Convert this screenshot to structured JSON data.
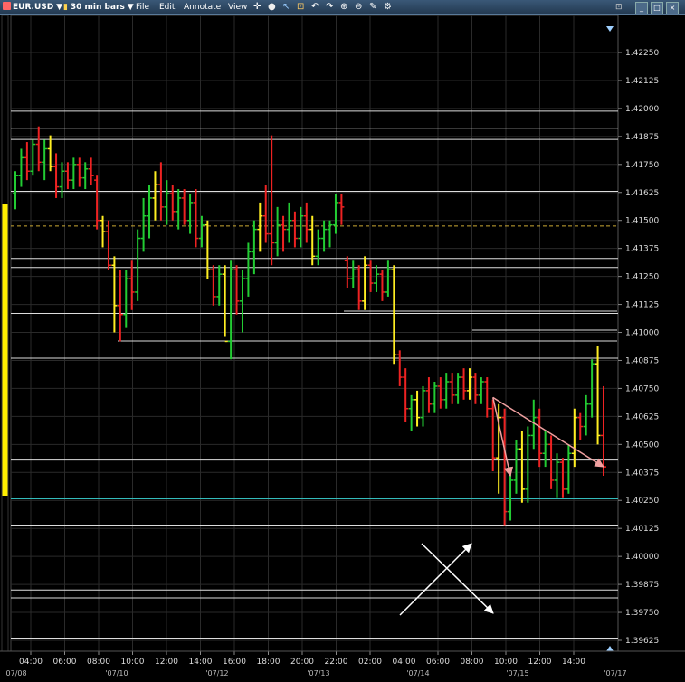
{
  "toolbar": {
    "symbol": "EUR.USD",
    "interval": "30 min bars",
    "menu": [
      {
        "label": "File"
      },
      {
        "label": "Edit"
      },
      {
        "label": "Annotate"
      },
      {
        "label": "View"
      }
    ],
    "tool_icons": [
      "crosshair-icon",
      "dot-icon",
      "pointer-icon",
      "measure-icon",
      "undo-icon",
      "redo-icon",
      "undo-icon-2",
      "zoom-in-icon",
      "zoom-out-icon",
      "zoom-reset-icon",
      "wrench-icon",
      "settings-icon",
      "lock-icon"
    ],
    "window_buttons": [
      "minimize-icon",
      "maximize-icon",
      "close-icon"
    ]
  },
  "colors": {
    "up": "#22cc33",
    "down": "#ee2222",
    "flat": "#ffee22",
    "neutral": "#eeeeee",
    "hline": "#dddddd",
    "dashed": "#ccaa33",
    "cyan": "#33bbbb",
    "arrow": "#f0a0a0",
    "grid": "#2a2a2a",
    "volume_bar": "#ffee00"
  },
  "chart_data": {
    "type": "ohlc",
    "ylim": [
      1.39625,
      1.42375
    ],
    "y_ticks": [
      "1.42250",
      "1.42125",
      "1.42000",
      "1.41875",
      "1.41750",
      "1.41625",
      "1.41500",
      "1.41375",
      "1.41250",
      "1.41125",
      "1.41000",
      "1.40875",
      "1.40750",
      "1.40625",
      "1.40500",
      "1.40375",
      "1.40250",
      "1.40125",
      "1.40000",
      "1.39875",
      "1.39750",
      "1.39625"
    ],
    "x_ticks": [
      "04:00",
      "06:00",
      "08:00",
      "10:00",
      "12:00",
      "14:00",
      "16:00",
      "18:00",
      "20:00",
      "22:00",
      "02:00",
      "04:00",
      "06:00",
      "08:00",
      "10:00",
      "12:00",
      "14:00"
    ],
    "x_dates": [
      "'07/08",
      "'07/10",
      "'07/12",
      "'07/13",
      "'07/14",
      "'07/15",
      "'07/17"
    ],
    "horizontal_lines": [
      1.41988,
      1.41912,
      1.41862,
      1.4163,
      1.4133,
      1.4129,
      1.41085,
      1.40885,
      1.4043,
      1.4014,
      1.3985,
      1.39815,
      1.39635
    ],
    "dashed_line": 1.41475,
    "cyan_line": 1.40257,
    "bars": [
      {
        "o": 1.4162,
        "h": 1.4172,
        "l": 1.4155,
        "c": 1.417
      },
      {
        "o": 1.417,
        "h": 1.4182,
        "l": 1.4165,
        "c": 1.4178
      },
      {
        "o": 1.4178,
        "h": 1.4185,
        "l": 1.4168,
        "c": 1.4172
      },
      {
        "o": 1.4172,
        "h": 1.4186,
        "l": 1.417,
        "c": 1.4184
      },
      {
        "o": 1.4184,
        "h": 1.4192,
        "l": 1.4172,
        "c": 1.4176
      },
      {
        "o": 1.4176,
        "h": 1.4186,
        "l": 1.4168,
        "c": 1.4182
      },
      {
        "o": 1.4182,
        "h": 1.4188,
        "l": 1.4172,
        "c": 1.4174
      },
      {
        "o": 1.4174,
        "h": 1.418,
        "l": 1.416,
        "c": 1.4165
      },
      {
        "o": 1.4165,
        "h": 1.4176,
        "l": 1.416,
        "c": 1.4172
      },
      {
        "o": 1.4172,
        "h": 1.4176,
        "l": 1.4164,
        "c": 1.4168
      },
      {
        "o": 1.4168,
        "h": 1.4178,
        "l": 1.4164,
        "c": 1.4175
      },
      {
        "o": 1.4175,
        "h": 1.4178,
        "l": 1.4165,
        "c": 1.4169
      },
      {
        "o": 1.4169,
        "h": 1.4176,
        "l": 1.4164,
        "c": 1.4173
      },
      {
        "o": 1.4173,
        "h": 1.4178,
        "l": 1.4166,
        "c": 1.417
      },
      {
        "o": 1.4168,
        "h": 1.417,
        "l": 1.4146,
        "c": 1.415
      },
      {
        "o": 1.415,
        "h": 1.4152,
        "l": 1.4138,
        "c": 1.4145
      },
      {
        "o": 1.4145,
        "h": 1.415,
        "l": 1.4128,
        "c": 1.413
      },
      {
        "o": 1.413,
        "h": 1.4134,
        "l": 1.41,
        "c": 1.4112
      },
      {
        "o": 1.4112,
        "h": 1.4128,
        "l": 1.4096,
        "c": 1.4108
      },
      {
        "o": 1.4108,
        "h": 1.4128,
        "l": 1.4102,
        "c": 1.4124
      },
      {
        "o": 1.4124,
        "h": 1.4132,
        "l": 1.411,
        "c": 1.4118
      },
      {
        "o": 1.4118,
        "h": 1.4146,
        "l": 1.4114,
        "c": 1.4142
      },
      {
        "o": 1.4142,
        "h": 1.416,
        "l": 1.4136,
        "c": 1.4152
      },
      {
        "o": 1.4152,
        "h": 1.4166,
        "l": 1.4142,
        "c": 1.416
      },
      {
        "o": 1.416,
        "h": 1.4172,
        "l": 1.415,
        "c": 1.4166
      },
      {
        "o": 1.4166,
        "h": 1.4176,
        "l": 1.415,
        "c": 1.4156
      },
      {
        "o": 1.4156,
        "h": 1.4168,
        "l": 1.4148,
        "c": 1.4162
      },
      {
        "o": 1.4162,
        "h": 1.4166,
        "l": 1.415,
        "c": 1.4154
      },
      {
        "o": 1.4154,
        "h": 1.4164,
        "l": 1.4146,
        "c": 1.416
      },
      {
        "o": 1.416,
        "h": 1.4164,
        "l": 1.4148,
        "c": 1.415
      },
      {
        "o": 1.415,
        "h": 1.4162,
        "l": 1.4144,
        "c": 1.4158
      },
      {
        "o": 1.4158,
        "h": 1.4164,
        "l": 1.4138,
        "c": 1.4142
      },
      {
        "o": 1.4142,
        "h": 1.4152,
        "l": 1.4138,
        "c": 1.4148
      },
      {
        "o": 1.4148,
        "h": 1.415,
        "l": 1.4124,
        "c": 1.4128
      },
      {
        "o": 1.4128,
        "h": 1.413,
        "l": 1.4112,
        "c": 1.4116
      },
      {
        "o": 1.4116,
        "h": 1.413,
        "l": 1.4112,
        "c": 1.4126
      },
      {
        "o": 1.4126,
        "h": 1.413,
        "l": 1.4098,
        "c": 1.4096
      },
      {
        "o": 1.4096,
        "h": 1.4132,
        "l": 1.4088,
        "c": 1.4128
      },
      {
        "o": 1.4128,
        "h": 1.413,
        "l": 1.4108,
        "c": 1.4114
      },
      {
        "o": 1.4114,
        "h": 1.4128,
        "l": 1.41,
        "c": 1.4124
      },
      {
        "o": 1.4124,
        "h": 1.414,
        "l": 1.4116,
        "c": 1.4136
      },
      {
        "o": 1.4136,
        "h": 1.415,
        "l": 1.4126,
        "c": 1.4146
      },
      {
        "o": 1.4146,
        "h": 1.4158,
        "l": 1.4136,
        "c": 1.4152
      },
      {
        "o": 1.4152,
        "h": 1.4166,
        "l": 1.414,
        "c": 1.4144
      },
      {
        "o": 1.4144,
        "h": 1.4188,
        "l": 1.413,
        "c": 1.414
      },
      {
        "o": 1.414,
        "h": 1.4156,
        "l": 1.4134,
        "c": 1.4148
      },
      {
        "o": 1.4148,
        "h": 1.4152,
        "l": 1.4136,
        "c": 1.4146
      },
      {
        "o": 1.4146,
        "h": 1.4158,
        "l": 1.414,
        "c": 1.415
      },
      {
        "o": 1.415,
        "h": 1.4154,
        "l": 1.4138,
        "c": 1.4142
      },
      {
        "o": 1.4142,
        "h": 1.4156,
        "l": 1.4138,
        "c": 1.4152
      },
      {
        "o": 1.4152,
        "h": 1.4158,
        "l": 1.414,
        "c": 1.4146
      },
      {
        "o": 1.4146,
        "h": 1.4152,
        "l": 1.413,
        "c": 1.4134
      },
      {
        "o": 1.4134,
        "h": 1.4146,
        "l": 1.413,
        "c": 1.4142
      },
      {
        "o": 1.4142,
        "h": 1.415,
        "l": 1.4136,
        "c": 1.4146
      },
      {
        "o": 1.4146,
        "h": 1.415,
        "l": 1.4138,
        "c": 1.4148
      },
      {
        "o": 1.4148,
        "h": 1.4162,
        "l": 1.4144,
        "c": 1.4158
      },
      {
        "o": 1.4158,
        "h": 1.4162,
        "l": 1.4148,
        "c": 1.4156
      },
      {
        "o": 1.4132,
        "h": 1.4134,
        "l": 1.412,
        "c": 1.4124
      },
      {
        "o": 1.4124,
        "h": 1.4132,
        "l": 1.412,
        "c": 1.4128
      },
      {
        "o": 1.4128,
        "h": 1.413,
        "l": 1.411,
        "c": 1.4114
      },
      {
        "o": 1.4114,
        "h": 1.4134,
        "l": 1.411,
        "c": 1.413
      },
      {
        "o": 1.413,
        "h": 1.4132,
        "l": 1.4118,
        "c": 1.4122
      },
      {
        "o": 1.4122,
        "h": 1.413,
        "l": 1.4118,
        "c": 1.4126
      },
      {
        "o": 1.4126,
        "h": 1.4128,
        "l": 1.4114,
        "c": 1.4118
      },
      {
        "o": 1.4118,
        "h": 1.4132,
        "l": 1.4116,
        "c": 1.4128
      },
      {
        "o": 1.4128,
        "h": 1.413,
        "l": 1.4086,
        "c": 1.409
      },
      {
        "o": 1.409,
        "h": 1.4092,
        "l": 1.4076,
        "c": 1.408
      },
      {
        "o": 1.408,
        "h": 1.4084,
        "l": 1.406,
        "c": 1.4066
      },
      {
        "o": 1.4066,
        "h": 1.4072,
        "l": 1.4056,
        "c": 1.407
      },
      {
        "o": 1.407,
        "h": 1.4074,
        "l": 1.4058,
        "c": 1.4062
      },
      {
        "o": 1.4062,
        "h": 1.4076,
        "l": 1.4058,
        "c": 1.4074
      },
      {
        "o": 1.4074,
        "h": 1.408,
        "l": 1.4064,
        "c": 1.4068
      },
      {
        "o": 1.4068,
        "h": 1.4078,
        "l": 1.4064,
        "c": 1.4076
      },
      {
        "o": 1.4076,
        "h": 1.408,
        "l": 1.4066,
        "c": 1.407
      },
      {
        "o": 1.407,
        "h": 1.4082,
        "l": 1.4066,
        "c": 1.4078
      },
      {
        "o": 1.4078,
        "h": 1.4082,
        "l": 1.4068,
        "c": 1.4072
      },
      {
        "o": 1.4072,
        "h": 1.4082,
        "l": 1.4068,
        "c": 1.408
      },
      {
        "o": 1.408,
        "h": 1.4084,
        "l": 1.407,
        "c": 1.4074
      },
      {
        "o": 1.4074,
        "h": 1.4084,
        "l": 1.407,
        "c": 1.408
      },
      {
        "o": 1.408,
        "h": 1.4082,
        "l": 1.4068,
        "c": 1.4072
      },
      {
        "o": 1.4072,
        "h": 1.408,
        "l": 1.4068,
        "c": 1.4078
      },
      {
        "o": 1.4078,
        "h": 1.408,
        "l": 1.4062,
        "c": 1.4066
      },
      {
        "o": 1.4066,
        "h": 1.407,
        "l": 1.4038,
        "c": 1.4044
      },
      {
        "o": 1.4044,
        "h": 1.4068,
        "l": 1.4028,
        "c": 1.4062
      },
      {
        "o": 1.4062,
        "h": 1.4066,
        "l": 1.4014,
        "c": 1.402
      },
      {
        "o": 1.402,
        "h": 1.404,
        "l": 1.4016,
        "c": 1.4034
      },
      {
        "o": 1.4034,
        "h": 1.4052,
        "l": 1.4028,
        "c": 1.4048
      },
      {
        "o": 1.4048,
        "h": 1.4056,
        "l": 1.4024,
        "c": 1.403
      },
      {
        "o": 1.403,
        "h": 1.4058,
        "l": 1.4024,
        "c": 1.4054
      },
      {
        "o": 1.4054,
        "h": 1.407,
        "l": 1.4048,
        "c": 1.4062
      },
      {
        "o": 1.4062,
        "h": 1.4066,
        "l": 1.404,
        "c": 1.4046
      },
      {
        "o": 1.4046,
        "h": 1.4056,
        "l": 1.404,
        "c": 1.405
      },
      {
        "o": 1.405,
        "h": 1.4054,
        "l": 1.403,
        "c": 1.4034
      },
      {
        "o": 1.4034,
        "h": 1.4046,
        "l": 1.4026,
        "c": 1.4042
      },
      {
        "o": 1.4042,
        "h": 1.4044,
        "l": 1.4026,
        "c": 1.403
      },
      {
        "o": 1.403,
        "h": 1.405,
        "l": 1.4028,
        "c": 1.4046
      },
      {
        "o": 1.4046,
        "h": 1.4066,
        "l": 1.404,
        "c": 1.4062
      },
      {
        "o": 1.4062,
        "h": 1.4064,
        "l": 1.4052,
        "c": 1.4058
      },
      {
        "o": 1.4058,
        "h": 1.4072,
        "l": 1.4054,
        "c": 1.4068
      },
      {
        "o": 1.4068,
        "h": 1.4088,
        "l": 1.4062,
        "c": 1.4086
      },
      {
        "o": 1.4086,
        "h": 1.4094,
        "l": 1.405,
        "c": 1.4054
      },
      {
        "o": 1.4054,
        "h": 1.4076,
        "l": 1.4036,
        "c": 1.404
      }
    ],
    "trendlines": [
      {
        "x0": 82,
        "y0": 1.4071,
        "x1": 101,
        "y1": 1.404
      },
      {
        "x0": 82,
        "y0": 1.4071,
        "x1": 85,
        "y1": 1.4036
      }
    ]
  }
}
